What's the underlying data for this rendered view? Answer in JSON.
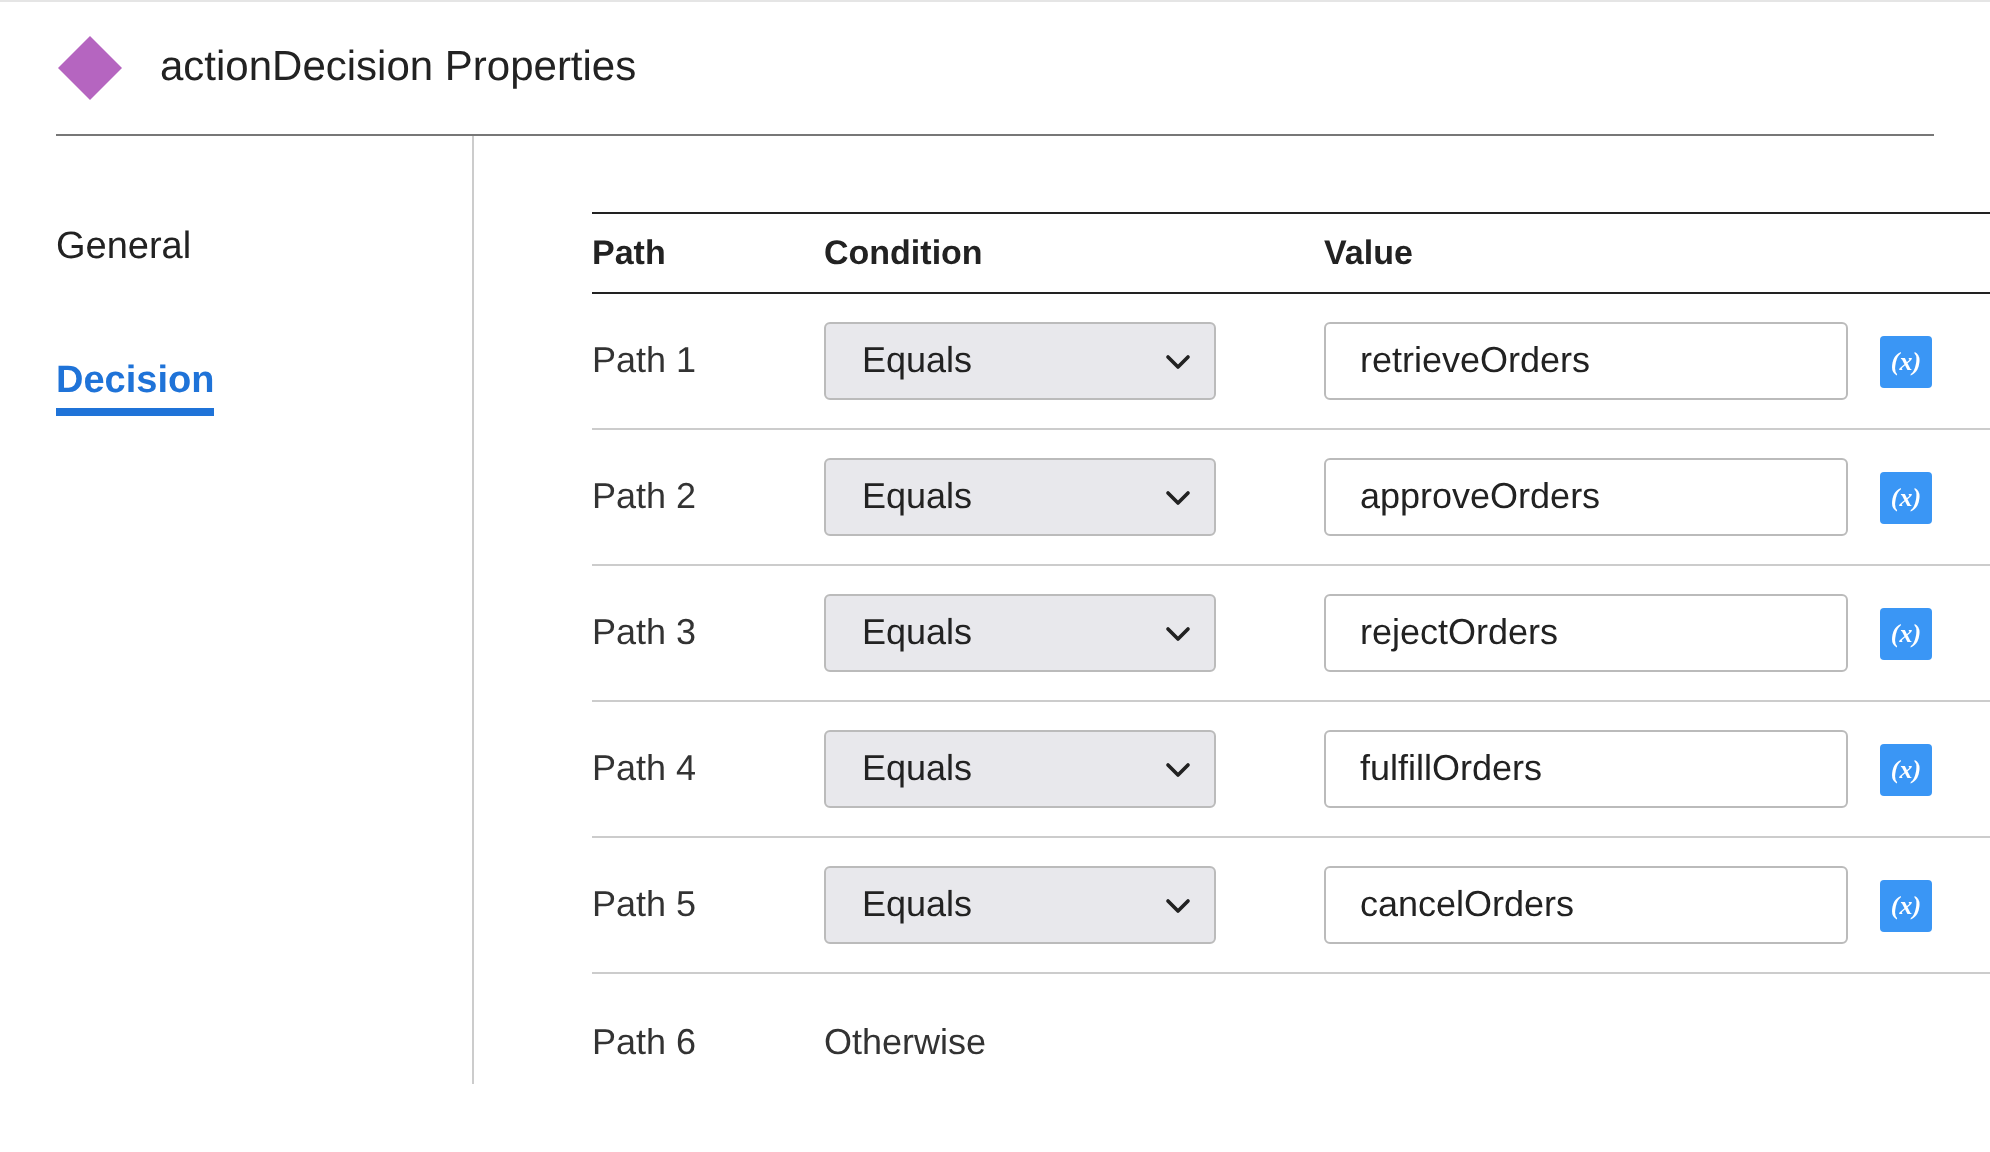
{
  "header": {
    "title": "actionDecision Properties"
  },
  "tabs": [
    {
      "label": "General",
      "selected": false
    },
    {
      "label": "Decision",
      "selected": true
    }
  ],
  "table": {
    "columns": [
      "Path",
      "Condition",
      "Value"
    ],
    "rows": [
      {
        "kind": "select",
        "path": "Path 1",
        "condition": "Equals",
        "value": "retrieveOrders",
        "expression_button": "(x)"
      },
      {
        "kind": "select",
        "path": "Path 2",
        "condition": "Equals",
        "value": "approveOrders",
        "expression_button": "(x)"
      },
      {
        "kind": "select",
        "path": "Path 3",
        "condition": "Equals",
        "value": "rejectOrders",
        "expression_button": "(x)"
      },
      {
        "kind": "select",
        "path": "Path 4",
        "condition": "Equals",
        "value": "fulfillOrders",
        "expression_button": "(x)"
      },
      {
        "kind": "select",
        "path": "Path 5",
        "condition": "Equals",
        "value": "cancelOrders",
        "expression_button": "(x)"
      },
      {
        "kind": "otherwise",
        "path": "Path 6",
        "condition": "Otherwise"
      }
    ]
  }
}
